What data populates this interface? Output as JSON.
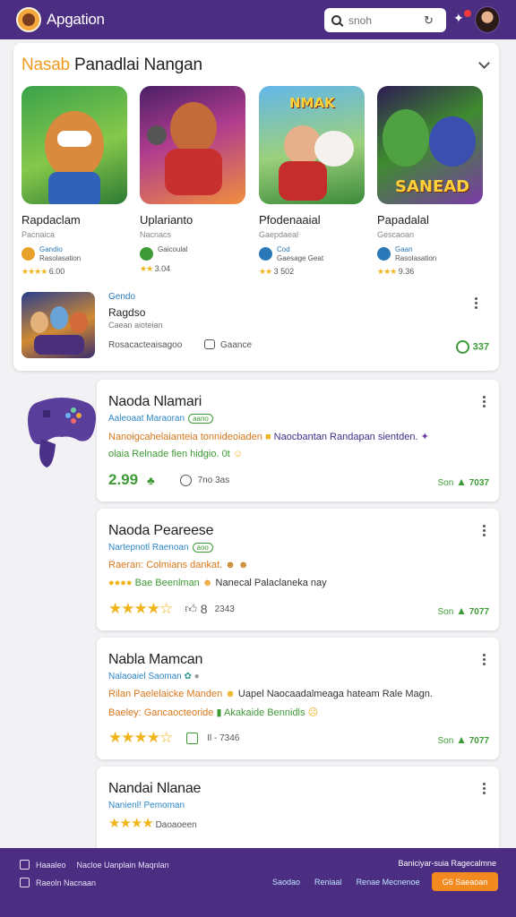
{
  "header": {
    "app_name": "Apgation",
    "search_placeholder": "snoh"
  },
  "featured": {
    "title_accent": "Nasab",
    "title": "Panadlai Nangan",
    "tiles": [
      {
        "name": "Rapdaclam",
        "sub": "Pacnaica",
        "meta1": "Gandio",
        "meta2": "Rasolasation",
        "stars": "★★★★",
        "rating": "6.00"
      },
      {
        "name": "Uplarianto",
        "sub": "Nacnacs",
        "meta1": "",
        "meta2": "Gaicoulal",
        "stars": "★★",
        "rating": "3.04"
      },
      {
        "name": "Pfodenaaial",
        "sub": "Gaepdaeal",
        "meta1": "Cod",
        "meta2": "Gaesage Geat",
        "stars": "★★",
        "rating": "3 502"
      },
      {
        "name": "Papadalal",
        "sub": "Gescaoan",
        "meta1": "Gaan",
        "meta2": "Rasolasation",
        "stars": "★★★",
        "rating": "9.36"
      }
    ],
    "art_text_3": "NMAK",
    "art_text_4": "SANEAD",
    "row": {
      "line1": "Gendo",
      "line2": "Ragdso",
      "line3": "Caean aioteian",
      "line4": "Rosacacteaisagoo",
      "line5": "Gaance",
      "score": "337"
    }
  },
  "posts": [
    {
      "title": "Naoda Nlamari",
      "meta": "Aaleoaat Maraoran",
      "pill": "aano",
      "line1": "Nanoigcahelaianteia tonnideoiaden",
      "line1b": "Naocbantan Randapan sientden.",
      "line2": "olaia Relnade fien hidgio. 0t",
      "stat": "2.99",
      "foot": "7no 3as",
      "score_label": "Son",
      "score": "7037"
    },
    {
      "title": "Naoda Peareese",
      "meta": "Nartepnotl Raenoan",
      "pill": "aoo",
      "line1": "Raeran: Colmians dankat.",
      "line2": "Bae Beenlman",
      "line2b": "Nanecal Palaclaneka nay",
      "stars": "★★★★☆",
      "foot": "8",
      "foot2": "2343",
      "score_label": "Son",
      "score": "7077"
    },
    {
      "title": "Nabla Mamcan",
      "meta": "Nalaoaiel Saoman",
      "line1": "Rilan Paelelaicke Manden",
      "line1b": "Uapel  Naocaadalmeaga hateam Rale Magn.",
      "line2": "Baeley: Gancaocteoride",
      "line2b": "Akakaide Bennidls",
      "stars": "★★★★☆",
      "foot": "Il - 7346",
      "score_label": "Son",
      "score": "7077"
    },
    {
      "title": "Nandai Nlanae",
      "meta": "Nanienl! Pemoman",
      "stars": "★★★★",
      "foot": "Daoaoeen"
    }
  ],
  "footer": {
    "item1": "Haaaleo",
    "item1b": "Nacloe  Uanplain Maqnlan",
    "item2": "Raeoln  Nacnaan",
    "right": "Baniciyar-suia  Ragecalmne",
    "links": [
      "Saodao",
      "Reniaal",
      "Renae Mecnenoe"
    ],
    "cta": "G6 Saeaoan"
  }
}
